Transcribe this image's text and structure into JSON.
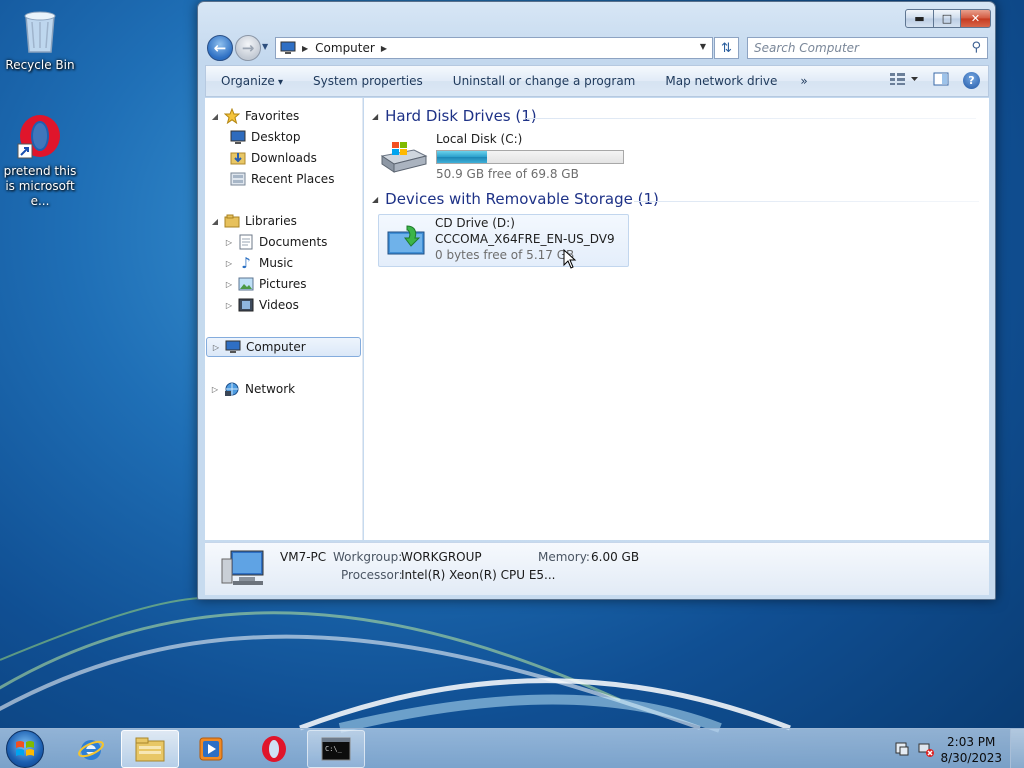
{
  "desktop": {
    "recycle_bin_label": "Recycle Bin",
    "opera_label": "pretend this is microsoft e..."
  },
  "window": {
    "address": {
      "root_icon": "computer-icon",
      "crumb": "Computer"
    },
    "search_placeholder": "Search Computer",
    "commands": {
      "organize": "Organize",
      "system_properties": "System properties",
      "uninstall": "Uninstall or change a program",
      "map_drive": "Map network drive",
      "more": "»"
    },
    "nav": {
      "favorites": "Favorites",
      "desktop": "Desktop",
      "downloads": "Downloads",
      "recent_places": "Recent Places",
      "libraries": "Libraries",
      "documents": "Documents",
      "music": "Music",
      "pictures": "Pictures",
      "videos": "Videos",
      "computer": "Computer",
      "network": "Network"
    },
    "groups": {
      "hard_disks": "Hard Disk Drives (1)",
      "removable": "Devices with Removable Storage (1)"
    },
    "local_disk": {
      "name": "Local Disk (C:)",
      "free_text": "50.9 GB free of 69.8 GB",
      "used_fraction": 0.271
    },
    "cd_drive": {
      "name": "CD Drive (D:)",
      "label": "CCCOMA_X64FRE_EN-US_DV9",
      "free_text": "0 bytes free of 5.17 GB"
    },
    "details": {
      "pc_name": "VM7-PC",
      "workgroup_label": "Workgroup:",
      "workgroup": "WORKGROUP",
      "memory_label": "Memory:",
      "memory": "6.00 GB",
      "processor_label": "Processor:",
      "processor": "Intel(R) Xeon(R) CPU E5..."
    }
  },
  "taskbar": {
    "time": "2:03 PM",
    "date": "8/30/2023"
  }
}
